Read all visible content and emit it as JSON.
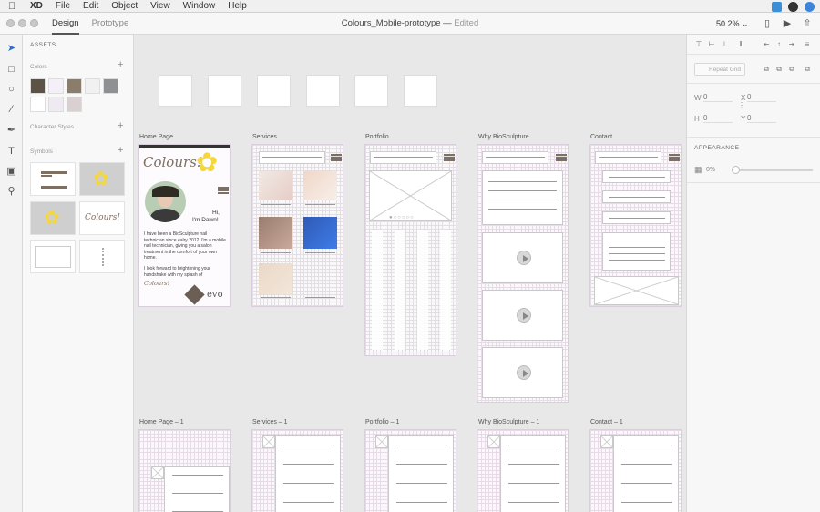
{
  "menubar": {
    "app": "XD",
    "items": [
      "File",
      "Edit",
      "Object",
      "View",
      "Window",
      "Help"
    ]
  },
  "titlebar": {
    "tab_design": "Design",
    "tab_prototype": "Prototype",
    "doc_title": "Colours_Mobile-prototype",
    "separator": "—",
    "status": "Edited",
    "zoom": "50.2%"
  },
  "assets": {
    "heading": "ASSETS",
    "colors_label": "Colors",
    "character_styles_label": "Character Styles",
    "symbols_label": "Symbols",
    "swatches": [
      "#5d5246",
      "#f5f0f8",
      "#8a7d6b",
      "#f1f1f1",
      "#8d9194",
      "#ffffff",
      "#efe9f1",
      "#d9d1d1"
    ],
    "symbol_text": "Colours!"
  },
  "artboards": {
    "home": "Home Page",
    "services": "Services",
    "portfolio": "Portfolio",
    "why": "Why BioSculpture",
    "contact": "Contact",
    "home1": "Home Page – 1",
    "services1": "Services – 1",
    "portfolio1": "Portfolio – 1",
    "why1": "Why BioSculpture – 1",
    "contact1": "Contact – 1"
  },
  "home_content": {
    "logo": "Colours!",
    "greeting_1": "Hi,",
    "greeting_2": "I'm Dawn!",
    "para1": "I have been a BioSculpture nail technician since ealry 2012. I'm a mobile nail technician, giving you a salon treatment in the comfort of your own home.",
    "para2": "I look forward to brightening your handshake with my splash of",
    "sign": "Colours!",
    "evo": "evo"
  },
  "properties": {
    "repeat_grid": "Repeat Grid",
    "w_label": "W",
    "w_value": "0",
    "x_label": "X",
    "x_value": "0",
    "h_label": "H",
    "h_value": "0",
    "y_label": "Y",
    "y_value": "0",
    "appearance": "APPEARANCE",
    "opacity": "0%"
  },
  "colors": {
    "accent": "#7e6f63",
    "flower": "#f4d63e"
  }
}
